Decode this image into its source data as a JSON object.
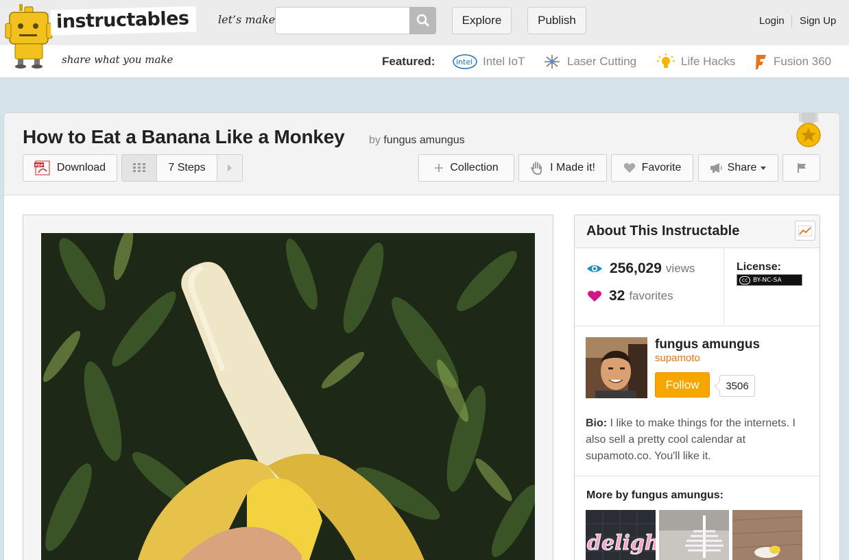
{
  "header": {
    "logo_text": "instructables",
    "tagline": "share what you make",
    "search_prompt": "let’s make",
    "search_value": "",
    "explore_label": "Explore",
    "publish_label": "Publish",
    "login_label": "Login",
    "signup_label": "Sign Up"
  },
  "featured": {
    "label": "Featured:",
    "items": [
      {
        "label": "Intel IoT",
        "icon": "intel-icon"
      },
      {
        "label": "Laser Cutting",
        "icon": "laser-icon"
      },
      {
        "label": "Life Hacks",
        "icon": "lightbulb-icon"
      },
      {
        "label": "Fusion 360",
        "icon": "fusion-icon"
      }
    ]
  },
  "project": {
    "title": "How to Eat a Banana Like a Monkey",
    "by_prefix": "by",
    "author": "fungus amungus"
  },
  "toolbar": {
    "download_label": "Download",
    "steps_label": "7 Steps",
    "collection_label": "Collection",
    "made_it_label": "I Made it!",
    "favorite_label": "Favorite",
    "share_label": "Share"
  },
  "sidebar": {
    "title": "About This Instructable",
    "views_count": "256,029",
    "views_label": "views",
    "favorites_count": "32",
    "favorites_label": "favorites",
    "license_label": "License:",
    "license_badge": "BY-NC-SA",
    "license_cc": "cc",
    "author_name": "fungus amungus",
    "author_handle": "supamoto",
    "follow_label": "Follow",
    "follower_count": "3506",
    "bio_label": "Bio:",
    "bio_text": " I like to make things for the internets. I also sell a pretty cool calendar at supamoto.co. You'll like it.",
    "more_by_label": "More by fungus amungus:",
    "thumb_1_text": "delight"
  },
  "colors": {
    "accent_orange": "#f7a600",
    "handle_orange": "#e8731a",
    "views_blue": "#1b8fc6",
    "favorites_pink": "#d4148a"
  }
}
